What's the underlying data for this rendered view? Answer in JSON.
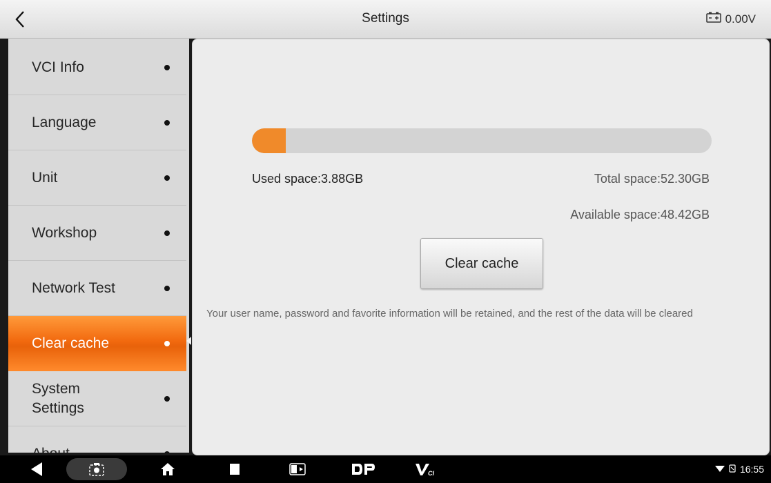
{
  "header": {
    "title": "Settings",
    "voltage": "0.00V",
    "back_icon": "chevron-left-icon",
    "battery_icon": "battery-icon"
  },
  "sidebar": {
    "items": [
      {
        "label": "VCI Info",
        "active": false
      },
      {
        "label": "Language",
        "active": false
      },
      {
        "label": "Unit",
        "active": false
      },
      {
        "label": "Workshop",
        "active": false
      },
      {
        "label": "Network Test",
        "active": false
      },
      {
        "label": "Clear cache",
        "active": true
      },
      {
        "label": "System Settings",
        "line1": "System",
        "line2": "Settings",
        "active": false
      },
      {
        "label": "About",
        "active": false
      }
    ]
  },
  "storage": {
    "used_fraction": 0.074,
    "used_label": "Used space:3.88GB",
    "total_label": "Total space:52.30GB",
    "available_label": "Available space:48.42GB",
    "clear_button_label": "Clear cache",
    "note": "Your user name, password and favorite information will be retained, and the rest of the data will be cleared"
  },
  "navbar": {
    "icons": [
      "back-triangle-icon",
      "screenshot-icon",
      "home-icon",
      "recents-icon",
      "dual-screen-icon",
      "dp-app-icon",
      "vci-app-icon"
    ],
    "status_time": "16:55",
    "status_icons": [
      "wifi-icon",
      "signal-icon"
    ]
  },
  "colors": {
    "accent": "#f08a2a",
    "active_item": "#f26a0f"
  }
}
